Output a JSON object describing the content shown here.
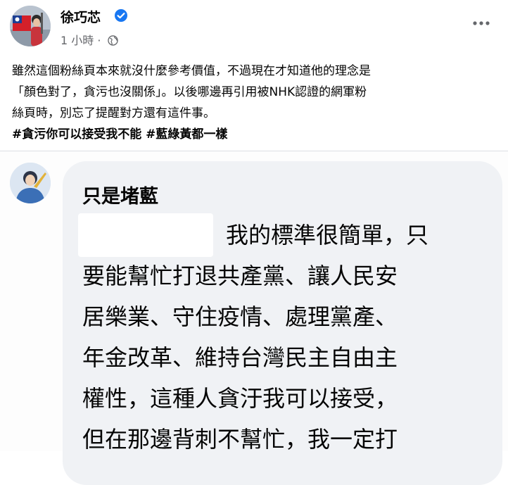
{
  "post": {
    "author": "徐巧芯",
    "timestamp": "1 小時",
    "meta_separator": "·",
    "body_lines": [
      "雖然這個粉絲頁本來就沒什麼參考價值，不過現在才知道他的理念是",
      "「顏色對了，貪污也沒關係」。以後哪邊再引用被NHK認證的網軍粉",
      "絲頁時，別忘了提醒對方還有這件事。"
    ],
    "hashtags": [
      "#貪污你可以接受我不能",
      "#藍綠黃都一樣"
    ]
  },
  "comment": {
    "author": "只是堵藍",
    "text_lines": [
      "我的標準很簡單，只",
      "要能幫忙打退共產黨、讓人民安",
      "居樂業、守住疫情、處理黨產、",
      "年金改革、維持台灣民主自由主",
      "權性，這種人貪汙我可以接受，",
      "但在那邊背刺不幫忙，我一定打"
    ]
  },
  "colors": {
    "text": "#050505",
    "meta": "#65676b",
    "verified": "#1877f2",
    "bubble": "#f0f2f5"
  },
  "icons": [
    "verified-badge-icon",
    "globe-icon",
    "more-options-icon"
  ]
}
